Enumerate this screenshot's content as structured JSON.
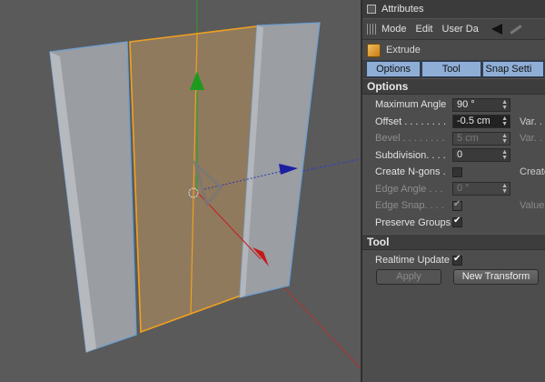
{
  "window": {
    "title": "Attributes"
  },
  "menu": {
    "items": [
      "Mode",
      "Edit",
      "User Da"
    ],
    "back_icon": "back-arrow-icon",
    "edit_icon": "pencil-icon"
  },
  "object": {
    "name": "Extrude",
    "icon": "cube-icon"
  },
  "tabs": [
    "Options",
    "Tool",
    "Snap Setti"
  ],
  "options": {
    "section_title": "Options",
    "maximum_angle": {
      "label": "Maximum Angle",
      "value": "90 °"
    },
    "offset": {
      "label": "Offset . . . . . . . .",
      "value": "-0.5 cm",
      "var": "Var. ."
    },
    "bevel": {
      "label": "Bevel . . . . . . . .",
      "value": "5 cm",
      "var": "Var. ."
    },
    "subdivision": {
      "label": "Subdivision. . . .",
      "value": "0"
    },
    "create_ngons": {
      "label": "Create N-gons .",
      "checked": false,
      "right": "Create"
    },
    "edge_angle": {
      "label": "Edge Angle . . .",
      "value": "0 °"
    },
    "edge_snap": {
      "label": "Edge Snap. . . .",
      "checked": true,
      "right": "Value"
    },
    "preserve_groups": {
      "label": "Preserve Groups",
      "checked": true
    }
  },
  "tool": {
    "section_title": "Tool",
    "realtime_update": {
      "label": "Realtime Update",
      "checked": true
    },
    "apply_label": "Apply",
    "new_transform_label": "New Transform"
  },
  "colors": {
    "tab": "#8faed6",
    "selection": "#f0a020",
    "viewport_bg": "#5a5a5a"
  }
}
